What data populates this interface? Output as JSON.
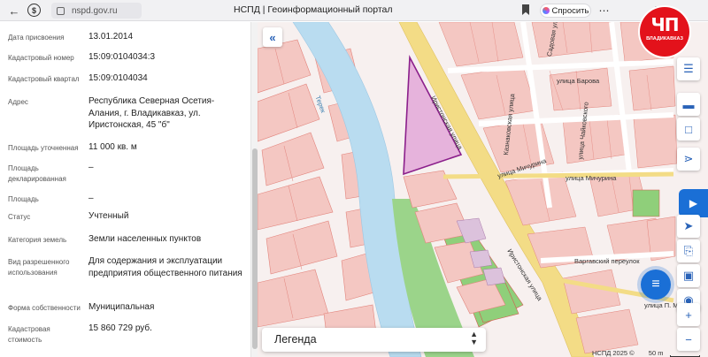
{
  "browser": {
    "url": "nspd.gov.ru",
    "page_title": "НСПД | Геоинформационный портал",
    "ask_label": "Спросить",
    "back_icon": "arrow-left-icon",
    "more_icon": "ellipsis-icon",
    "download_icon": "download-icon"
  },
  "info": {
    "rows": [
      {
        "label": "Дата присвоения",
        "value": "13.01.2014"
      },
      {
        "label": "Кадастровый номер",
        "value": "15:09:0104034:3"
      },
      {
        "label": "Кадастровый квартал",
        "value": "15:09:0104034"
      },
      {
        "label": "Адрес",
        "value": "Республика Северная Осетия-Алания, г. Владикавказ, ул. Иристонская, 45 \"б\""
      },
      {
        "label": "Площадь уточненная",
        "value": "11 000 кв. м"
      },
      {
        "label": "Площадь декларированная",
        "value": "–"
      },
      {
        "label": "Площадь",
        "value": "–"
      },
      {
        "label": "Статус",
        "value": "Учтенный"
      },
      {
        "label": "Категория земель",
        "value": "Земли населенных пунктов"
      },
      {
        "label": "Вид разрешенного использования",
        "value": "Для содержания и эксплуатации предприятия общественного питания"
      },
      {
        "label": "Форма собственности",
        "value": "Муниципальная"
      },
      {
        "label": "Кадастровая стоимость",
        "value": "15 860 729 руб."
      }
    ]
  },
  "map": {
    "legend_title": "Легенда",
    "scale_text": "НСПД 2025 ©",
    "scale_value": "50 m",
    "streets": {
      "iristonskaya_1": "Иристонская улица",
      "iristonskaya_2": "Иристонская улица",
      "barova": "улица Барова",
      "michurina": "улица Мичурина",
      "michurina_2": "улица Мичурина",
      "vorgavsky": "Варгавский переулок",
      "sadovaya": "Садовая улица",
      "chaykovskogo": "улица Чайковского",
      "kaznakovskaya": "Казнаковская улица",
      "lenina": "улица П. М.",
      "terek": "Терек"
    },
    "colors": {
      "parcel_fill": "#e6b3dc",
      "parcel_stroke": "#8b1f8b",
      "river": "#b9dcf0",
      "green": "#8fcf7a",
      "road": "#f3dc86",
      "block": "#f4c7c2"
    }
  },
  "logo": {
    "big": "ЧП",
    "small": "ВЛАДИКАВКАЗ"
  },
  "tools": {
    "collapse_icon": "double-chevron-left-icon",
    "layers_icon": "layers-icon",
    "ruler_icon": "ruler-icon",
    "select_area_icon": "select-area-icon",
    "share_icon": "share-icon",
    "feedback_icon": "feedback-icon",
    "locate_icon": "locate-arrow-icon",
    "print_icon": "print-icon",
    "screen_icon": "screen-icon",
    "pin_icon": "pin-icon",
    "zoom_in_icon": "plus-icon",
    "zoom_out_icon": "minus-icon",
    "chat_icon": "chat-icon"
  }
}
